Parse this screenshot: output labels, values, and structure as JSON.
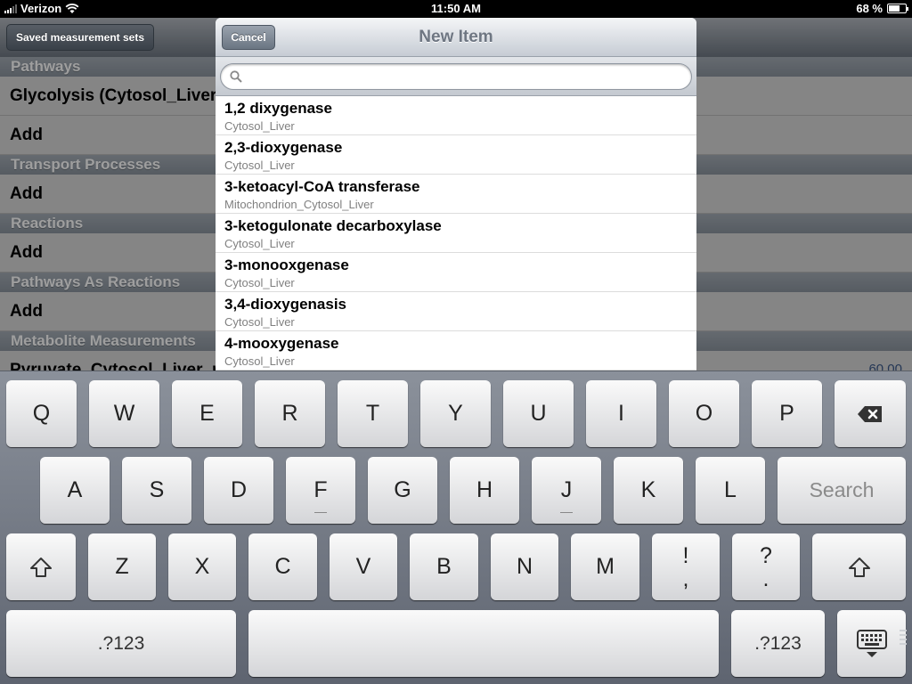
{
  "status_bar": {
    "carrier": "Verizon",
    "time": "11:50 AM",
    "battery": "68 %",
    "battery_level": 0.68
  },
  "background": {
    "back_button": "Saved measurement sets",
    "sections": [
      {
        "header": "Pathways",
        "rows": [
          "Glycolysis (Cytosol_Liver)",
          "Add"
        ]
      },
      {
        "header": "Transport Processes",
        "rows": [
          "Add"
        ]
      },
      {
        "header": "Reactions",
        "rows": [
          "Add"
        ]
      },
      {
        "header": "Pathways As Reactions",
        "rows": [
          "Add"
        ]
      },
      {
        "header": "Metabolite Measurements",
        "rows": [
          "Pyruvate_Cytosol_Liver_nec"
        ]
      }
    ],
    "measurement_value": "60.00"
  },
  "popover": {
    "title": "New Item",
    "cancel": "Cancel",
    "search_value": "",
    "items": [
      {
        "title": "1,2 dixygenase",
        "subtitle": "Cytosol_Liver"
      },
      {
        "title": "2,3-dioxygenase",
        "subtitle": "Cytosol_Liver"
      },
      {
        "title": "3-ketoacyl-CoA transferase",
        "subtitle": "Mitochondrion_Cytosol_Liver"
      },
      {
        "title": "3-ketogulonate decarboxylase",
        "subtitle": "Cytosol_Liver"
      },
      {
        "title": "3-monooxgenase",
        "subtitle": "Cytosol_Liver"
      },
      {
        "title": "3,4-dioxygenasis",
        "subtitle": "Cytosol_Liver"
      },
      {
        "title": "4-mooxygenase",
        "subtitle": "Cytosol_Liver"
      }
    ]
  },
  "keyboard": {
    "row1": [
      "Q",
      "W",
      "E",
      "R",
      "T",
      "Y",
      "U",
      "I",
      "O",
      "P"
    ],
    "row2": [
      "A",
      "S",
      "D",
      "F",
      "G",
      "H",
      "J",
      "K",
      "L"
    ],
    "row3": [
      "Z",
      "X",
      "C",
      "V",
      "B",
      "N",
      "M"
    ],
    "exclaim_key": [
      "!",
      ","
    ],
    "question_key": [
      "?",
      "."
    ],
    "search_key": "Search",
    "numbers_key": ".?123"
  }
}
